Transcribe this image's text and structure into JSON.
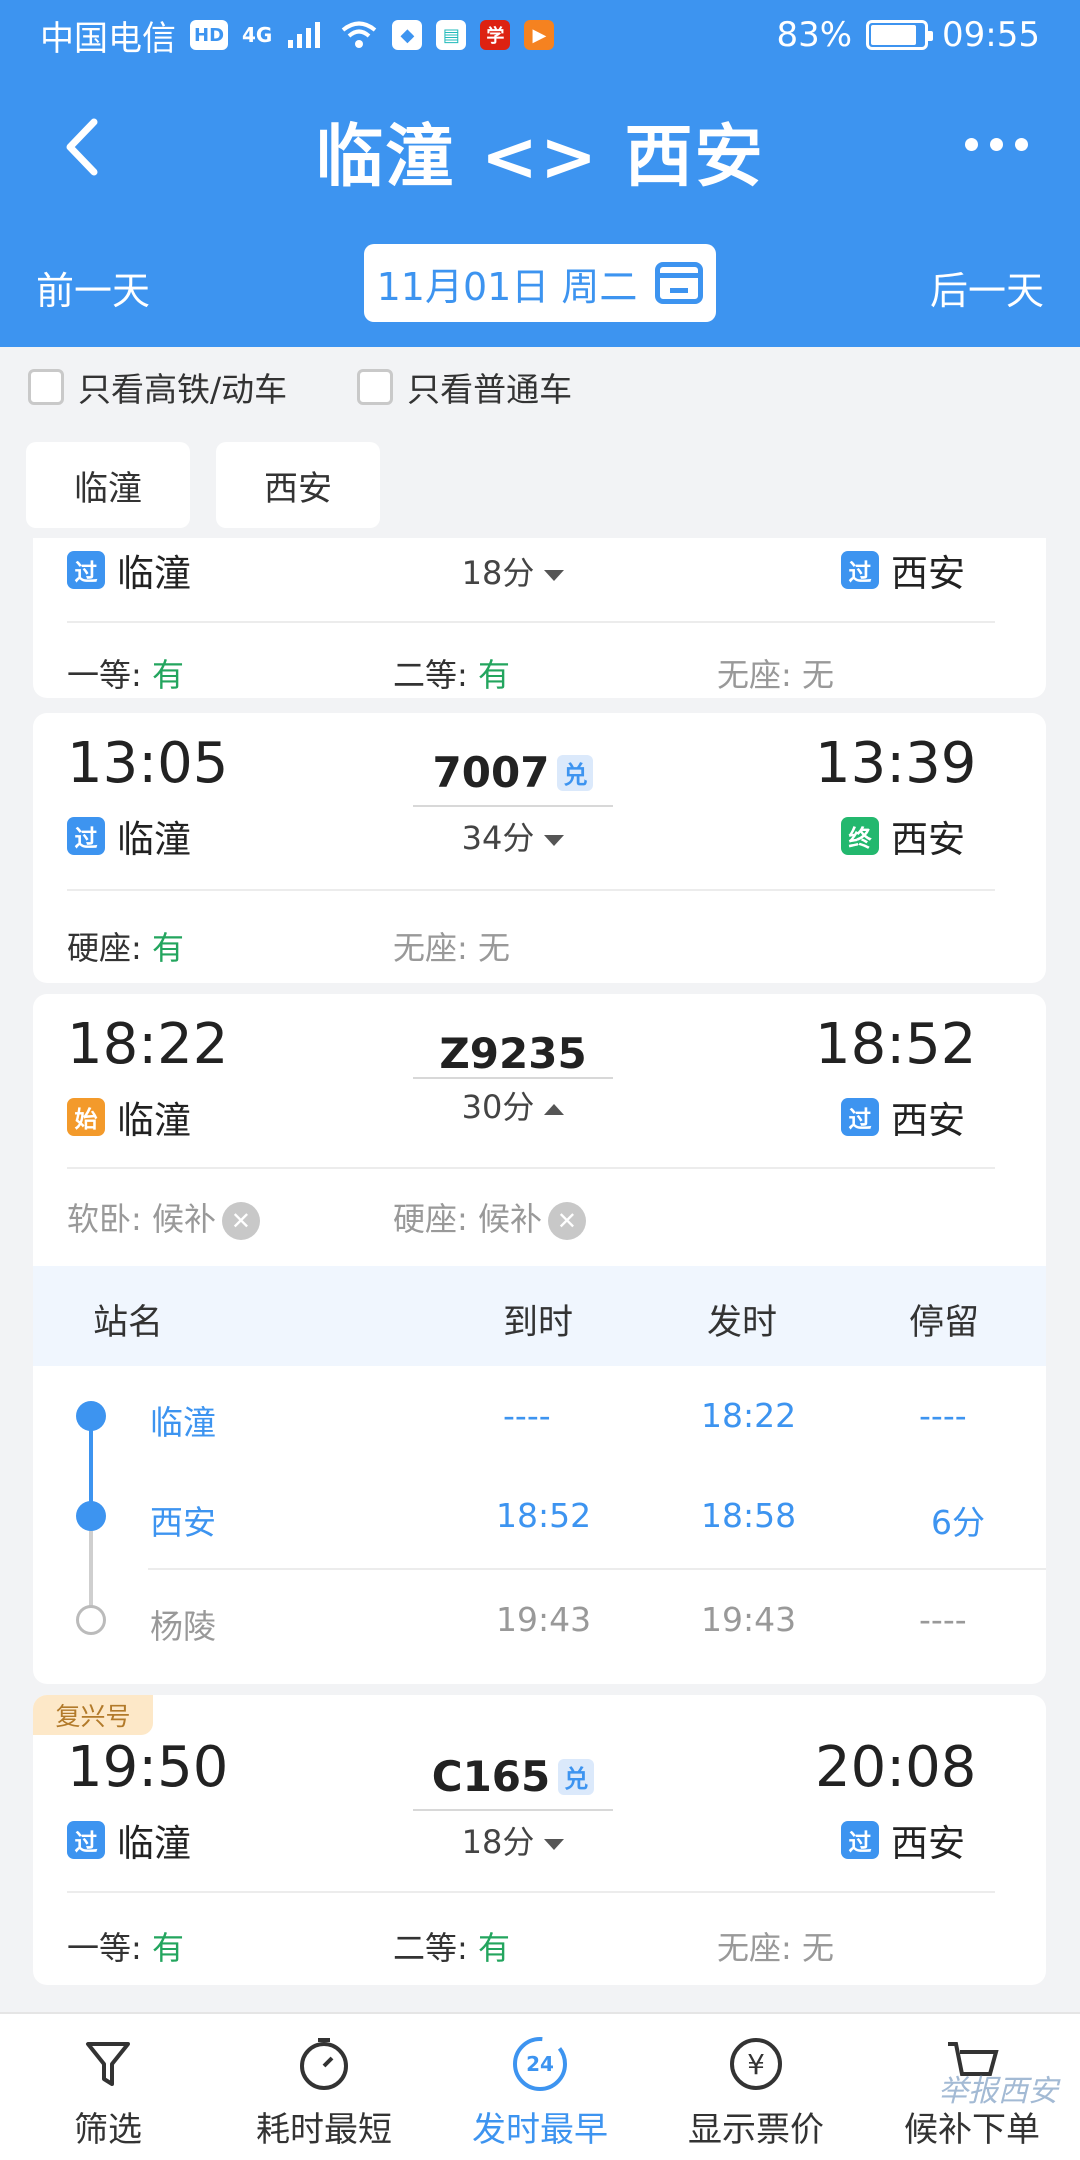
{
  "status_bar": {
    "carrier": "中国电信",
    "hd": "HD",
    "net": "4G",
    "battery": "83%",
    "time": "09:55"
  },
  "header": {
    "title": "临潼 <> 西安",
    "prev_day": "前一天",
    "next_day": "后一天",
    "date": "11月01日 周二"
  },
  "filters": {
    "high_speed": "只看高铁/动车",
    "normal": "只看普通车"
  },
  "station_tabs": [
    "临潼",
    "西安"
  ],
  "trains": [
    {
      "from_tag": "过",
      "from": "临潼",
      "duration": "18分",
      "to_tag": "过",
      "to": "西安",
      "seats": [
        {
          "label": "一等:",
          "value": "有"
        },
        {
          "label": "二等:",
          "value": "有"
        },
        {
          "label": "无座:",
          "value": "无"
        }
      ]
    },
    {
      "dep": "13:05",
      "arr": "13:39",
      "no": "7007",
      "dui": "兑",
      "from_tag": "过",
      "from": "临潼",
      "duration": "34分",
      "to_tag": "终",
      "to": "西安",
      "seats": [
        {
          "label": "硬座:",
          "value": "有"
        },
        {
          "label": "无座:",
          "value": "无"
        }
      ]
    },
    {
      "dep": "18:22",
      "arr": "18:52",
      "no": "Z9235",
      "from_tag": "始",
      "from": "临潼",
      "duration": "30分",
      "to_tag": "过",
      "to": "西安",
      "seats": [
        {
          "label": "软卧:",
          "value": "候补"
        },
        {
          "label": "硬座:",
          "value": "候补"
        }
      ],
      "stops_header": {
        "name": "站名",
        "arrive": "到时",
        "depart": "发时",
        "stay": "停留"
      },
      "stops": [
        {
          "name": "临潼",
          "arrive": "----",
          "depart": "18:22",
          "stay": "----"
        },
        {
          "name": "西安",
          "arrive": "18:52",
          "depart": "18:58",
          "stay": "6分"
        },
        {
          "name": "杨陵",
          "arrive": "19:43",
          "depart": "19:43",
          "stay": "----"
        }
      ]
    },
    {
      "badge": "复兴号",
      "dep": "19:50",
      "arr": "20:08",
      "no": "C165",
      "dui": "兑",
      "from_tag": "过",
      "from": "临潼",
      "duration": "18分",
      "to_tag": "过",
      "to": "西安",
      "seats": [
        {
          "label": "一等:",
          "value": "有"
        },
        {
          "label": "二等:",
          "value": "有"
        },
        {
          "label": "无座:",
          "value": "无"
        }
      ]
    }
  ],
  "bottom_bar": {
    "items": [
      {
        "label": "筛选",
        "icon": "filter-icon"
      },
      {
        "label": "耗时最短",
        "icon": "timer-icon"
      },
      {
        "label": "发时最早",
        "icon": "clock-24-icon",
        "badge": "24"
      },
      {
        "label": "显示票价",
        "icon": "yuan-icon"
      },
      {
        "label": "候补下单",
        "icon": "cart-icon"
      }
    ],
    "watermark": "举报西安"
  },
  "colors": {
    "primary": "#3d94f0",
    "green": "#23a55e",
    "orange": "#f39a2b"
  }
}
